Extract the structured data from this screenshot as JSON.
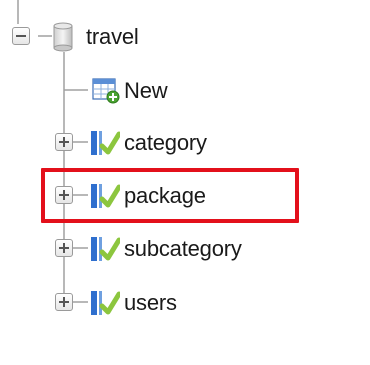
{
  "tree": {
    "database": {
      "label": "travel",
      "icon": "database-icon"
    },
    "items": [
      {
        "label": "New",
        "icon": "new-table-icon",
        "expandable": false
      },
      {
        "label": "category",
        "icon": "table-icon",
        "expandable": true
      },
      {
        "label": "package",
        "icon": "table-icon",
        "expandable": true,
        "highlighted": true
      },
      {
        "label": "subcategory",
        "icon": "table-icon",
        "expandable": true
      },
      {
        "label": "users",
        "icon": "table-icon",
        "expandable": true
      }
    ]
  },
  "colors": {
    "highlight_border": "#e3101b",
    "tree_lines": "#a0a0a0",
    "table_icon_blue": "#2f6fce",
    "table_icon_green": "#8cc63e"
  }
}
